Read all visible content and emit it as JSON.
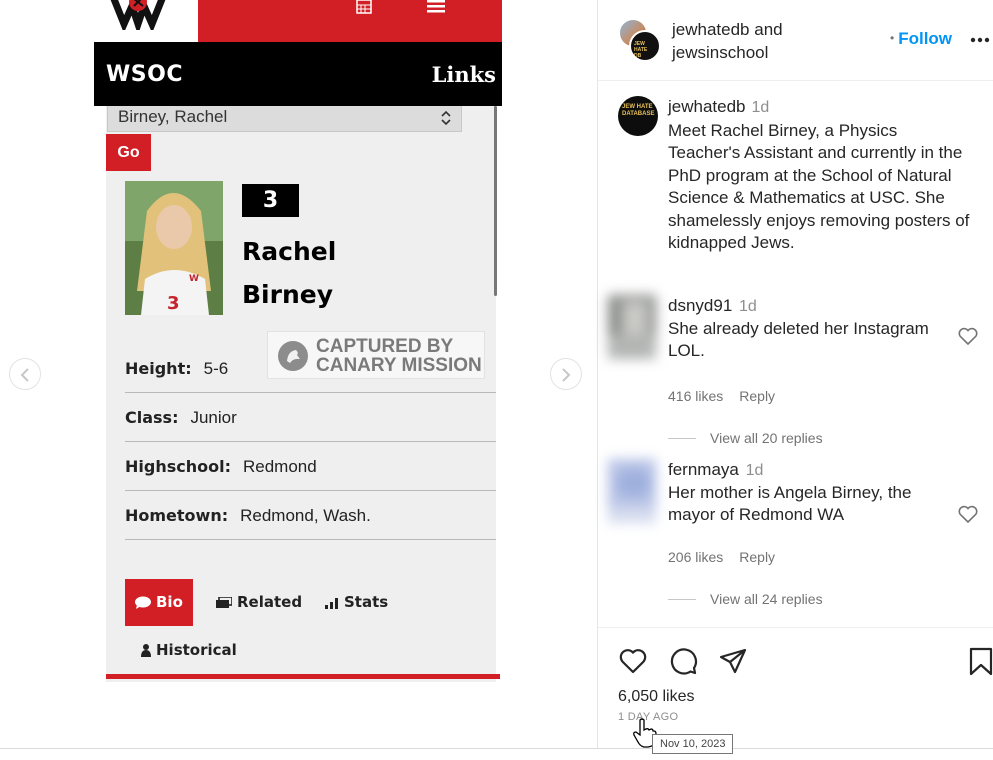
{
  "post_image": {
    "team_code": "WSOC",
    "links_label": "Links",
    "player_select_value": "Birney, Rachel",
    "go_label": "Go",
    "jersey_number": "3",
    "player_first_name": "Rachel",
    "player_last_name": "Birney",
    "watermark_line1": "CAPTURED BY",
    "watermark_line2": "CANARY MISSION",
    "info": [
      {
        "label": "Height:",
        "value": "5-6"
      },
      {
        "label": "Class:",
        "value": "Junior"
      },
      {
        "label": "Highschool:",
        "value": "Redmond"
      },
      {
        "label": "Hometown:",
        "value": "Redmond, Wash."
      }
    ],
    "tabs": [
      {
        "label": "Bio",
        "icon": "speech-bubble-icon"
      },
      {
        "label": "Related",
        "icon": "stack-icon"
      },
      {
        "label": "Stats",
        "icon": "bar-chart-icon"
      },
      {
        "label": "Historical",
        "icon": "person-icon"
      }
    ],
    "colors": {
      "brand_red": "#d21f26"
    }
  },
  "header": {
    "user1": "jewhatedb",
    "and_text": "and",
    "user2": "jewsinschool",
    "follow_label": "Follow"
  },
  "caption": {
    "avatar_text": "JEW HATE DATABASE",
    "username": "jewhatedb",
    "time": "1d",
    "text": "Meet Rachel Birney, a Physics Teacher's Assistant and currently in the PhD program at the School of Natural Science & Mathematics at USC. She shamelessly enjoys removing posters of kidnapped Jews."
  },
  "comments": [
    {
      "username": "dsnyd91",
      "time": "1d",
      "text": "She already deleted her Instagram LOL.",
      "likes": "416 likes",
      "reply_label": "Reply",
      "view_replies": "View all 20 replies"
    },
    {
      "username": "fernmaya",
      "time": "1d",
      "text": "Her mother is Angela Birney, the mayor of Redmond WA",
      "likes": "206 likes",
      "reply_label": "Reply",
      "view_replies": "View all 24 replies"
    }
  ],
  "footer": {
    "likes": "6,050 likes",
    "timestamp": "1 DAY AGO",
    "tooltip": "Nov 10, 2023"
  },
  "colors": {
    "link_blue": "#0095f6",
    "muted": "#737373"
  }
}
